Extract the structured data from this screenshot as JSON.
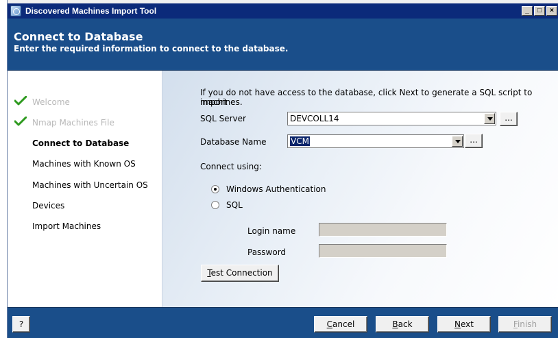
{
  "window": {
    "title": "Discovered Machines Import Tool",
    "controls": {
      "minimize": "_",
      "maximize": "□",
      "close": "×"
    }
  },
  "header": {
    "title": "Connect to Database",
    "subtitle": "Enter the required information to connect to the database."
  },
  "nav": {
    "items": [
      {
        "label": "Welcome",
        "state": "done"
      },
      {
        "label": "Nmap Machines File",
        "state": "done"
      },
      {
        "label": "Connect to Database",
        "state": "current"
      },
      {
        "label": "Machines with Known OS",
        "state": "pending"
      },
      {
        "label": "Machines with Uncertain OS",
        "state": "pending"
      },
      {
        "label": "Devices",
        "state": "pending"
      },
      {
        "label": "Import Machines",
        "state": "pending"
      }
    ]
  },
  "form": {
    "info_line1": "If you do not have access to the database, click Next to generate a SQL script to import",
    "info_line2": "machines.",
    "sql_server_label": "SQL Server",
    "sql_server_value": "DEVCOLL14",
    "database_name_label": "Database Name",
    "database_name_value": "VCM",
    "browse_label": "...",
    "connect_using_label": "Connect using:",
    "windows_auth_label": "Windows Authentication",
    "sql_label": "SQL",
    "auth_selected": "windows",
    "login_name_label": "Login name",
    "password_label": "Password",
    "login_name_value": "",
    "password_value": "",
    "test_connection_mnemonic": "T",
    "test_connection_rest": "est Connection"
  },
  "footer": {
    "help_label": "?",
    "cancel": {
      "mnemonic": "C",
      "rest": "ancel"
    },
    "back": {
      "mnemonic": "B",
      "rest": "ack"
    },
    "next": {
      "mnemonic": "N",
      "rest": "ext"
    },
    "finish": {
      "mnemonic": "F",
      "rest": "inish"
    }
  },
  "colors": {
    "titlebar": "#0b2a7a",
    "banner": "#1a4e8a",
    "check": "#2e9a1f",
    "selection": "#0a246a"
  },
  "icons": {
    "app": "app-icon",
    "done": "check-icon",
    "dropdown": "chevron-down-icon"
  }
}
